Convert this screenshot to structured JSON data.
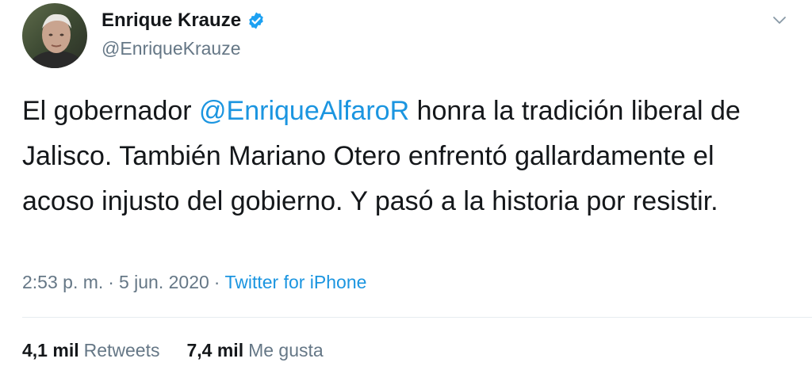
{
  "author": {
    "name": "Enrique Krauze",
    "handle": "@EnriqueKrauze",
    "verified": true,
    "avatar_icon": "profile-photo"
  },
  "menu": {
    "icon": "chevron-down-icon"
  },
  "tweet": {
    "text_before": "El gobernador ",
    "mention": "@EnriqueAlfaroR",
    "text_after": " honra la tradición liberal de Jalisco. También Mariano Otero enfrentó gallardamente el acoso injusto del gobierno. Y pasó a la historia por resistir."
  },
  "meta": {
    "time": "2:53 p. m.",
    "separator": "·",
    "date": "5 jun. 2020",
    "source": "Twitter for iPhone"
  },
  "stats": {
    "retweets_count": "4,1 mil",
    "retweets_label": "Retweets",
    "likes_count": "7,4 mil",
    "likes_label": "Me gusta"
  },
  "colors": {
    "link": "#1b95e0",
    "secondary_text": "#657786",
    "primary_text": "#14171a",
    "verified_badge": "#1da1f2"
  }
}
